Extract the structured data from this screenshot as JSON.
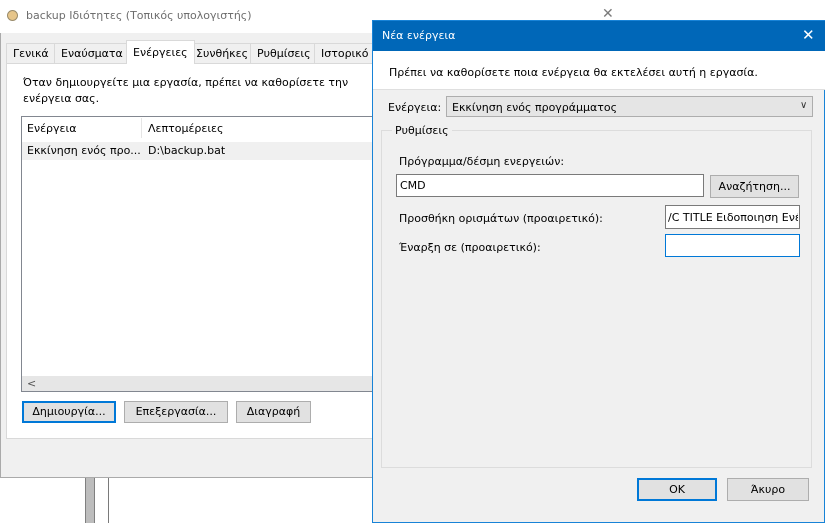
{
  "background_window": {
    "title": "backup Ιδιότητες (Τοπικός υπολογιστής)",
    "close_glyph": "✕",
    "icon": "task-clock-icon",
    "tabs": [
      {
        "label": "Γενικά"
      },
      {
        "label": "Εναύσματα"
      },
      {
        "label": "Ενέργειες",
        "active": true
      },
      {
        "label": "Συνθήκες"
      },
      {
        "label": "Ρυθμίσεις"
      },
      {
        "label": "Ιστορικό ("
      }
    ],
    "description": "Όταν δημιουργείτε μια εργασία, πρέπει να καθορίσετε την ενέργεια σας.",
    "table": {
      "columns": [
        "Ενέργεια",
        "Λεπτομέρειες"
      ],
      "rows": [
        [
          "Εκκίνηση ενός προ...",
          "D:\\backup.bat"
        ]
      ]
    },
    "scroll_left_glyph": "<",
    "buttons": {
      "create": "Δημιουργία...",
      "edit": "Επεξεργασία...",
      "delete": "Διαγραφή"
    }
  },
  "dialog": {
    "title": "Νέα ενέργεια",
    "close_glyph": "✕",
    "intro": "Πρέπει να καθορίσετε ποια ενέργεια θα εκτελέσει αυτή η εργασία.",
    "action_label": "Ενέργεια:",
    "action_value": "Εκκίνηση ενός προγράμματος",
    "chevron_glyph": "∨",
    "group_title": "Ρυθμίσεις",
    "program_label": "Πρόγραμμα/δέσμη ενεργειών:",
    "program_value": "CMD",
    "browse_label": "Αναζήτηση...",
    "args_label": "Προσθήκη ορισμάτων (προαιρετικό):",
    "args_value": "/C TITLE Ειδοποιηση Ενέ",
    "start_label": "Έναρξη σε (προαιρετικό):",
    "start_value": "",
    "ok_label": "OK",
    "cancel_label": "Άκυρο",
    "accent_color": "#0067b8"
  }
}
